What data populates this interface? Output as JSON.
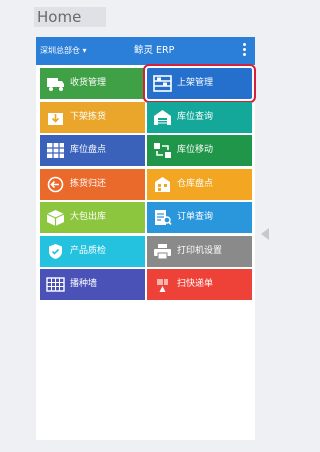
{
  "header": {
    "home_label": "Home"
  },
  "topbar": {
    "location": "深圳总部仓 ▾",
    "app_title": "鲸灵 ERP"
  },
  "menu": [
    {
      "label": "收货管理",
      "color": "#3fa046",
      "icon": "truck-icon"
    },
    {
      "label": "上架管理",
      "color": "#2470cc",
      "icon": "shelf-icon"
    },
    {
      "label": "下架拣货",
      "color": "#e9a62b",
      "icon": "box-down-icon"
    },
    {
      "label": "库位查询",
      "color": "#13a89a",
      "icon": "warehouse-icon"
    },
    {
      "label": "库位盘点",
      "color": "#3a62bb",
      "icon": "grid-icon"
    },
    {
      "label": "库位移动",
      "color": "#20964a",
      "icon": "move-icon"
    },
    {
      "label": "拣货归还",
      "color": "#ea6a2c",
      "icon": "return-icon"
    },
    {
      "label": "仓库盘点",
      "color": "#f2a622",
      "icon": "building-icon"
    },
    {
      "label": "大包出库",
      "color": "#8cc63f",
      "icon": "package-icon"
    },
    {
      "label": "订单查询",
      "color": "#2a97dc",
      "icon": "order-search-icon"
    },
    {
      "label": "产品质检",
      "color": "#25c2e0",
      "icon": "shield-check-icon"
    },
    {
      "label": "打印机设置",
      "color": "#8a8a8a",
      "icon": "printer-icon"
    },
    {
      "label": "播种墙",
      "color": "#4a52b8",
      "icon": "wall-icon"
    },
    {
      "label": "扫快递单",
      "color": "#ee4238",
      "icon": "scan-icon"
    }
  ],
  "highlighted_index": 1
}
